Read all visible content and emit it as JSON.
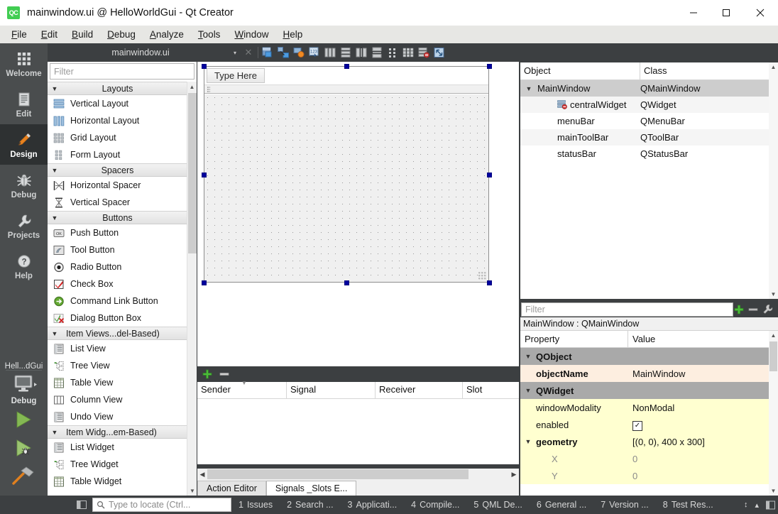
{
  "window": {
    "title": "mainwindow.ui @ HelloWorldGui - Qt Creator",
    "logo_text": "QC",
    "minimize": "—",
    "maximize": "☐",
    "close": "✕"
  },
  "menubar": {
    "items": [
      {
        "label": "File",
        "mnemonic": "F"
      },
      {
        "label": "Edit",
        "mnemonic": "E"
      },
      {
        "label": "Build",
        "mnemonic": "B"
      },
      {
        "label": "Debug",
        "mnemonic": "D"
      },
      {
        "label": "Analyze",
        "mnemonic": "A"
      },
      {
        "label": "Tools",
        "mnemonic": "T"
      },
      {
        "label": "Window",
        "mnemonic": "W"
      },
      {
        "label": "Help",
        "mnemonic": "H"
      }
    ]
  },
  "modebar": {
    "modes": [
      {
        "label": "Welcome",
        "icon": "grid-icon",
        "active": false
      },
      {
        "label": "Edit",
        "icon": "document-icon",
        "active": false
      },
      {
        "label": "Design",
        "icon": "pencil-icon",
        "active": true
      },
      {
        "label": "Debug",
        "icon": "bug-icon",
        "active": false
      },
      {
        "label": "Projects",
        "icon": "wrench-icon",
        "active": false
      },
      {
        "label": "Help",
        "icon": "question-icon",
        "active": false
      }
    ],
    "kit": {
      "project": "Hell...dGui",
      "build_config": "Debug",
      "icon": "monitor-icon",
      "run_label": "run-button",
      "debug_label": "start-debugging-button",
      "build_label": "build-button"
    }
  },
  "editor_toolbar": {
    "open_file": "mainwindow.ui",
    "dropdown_arrow": "▾",
    "close_editor": "✕",
    "tools": [
      {
        "name": "edit-widgets-icon"
      },
      {
        "name": "edit-signals-slots-icon"
      },
      {
        "name": "edit-buddies-icon"
      },
      {
        "name": "edit-tab-order-icon"
      },
      {
        "name": "layout-horizontally-icon"
      },
      {
        "name": "layout-vertically-icon"
      },
      {
        "name": "layout-in-splitter-horizontal-icon"
      },
      {
        "name": "layout-in-splitter-vertical-icon"
      },
      {
        "name": "layout-in-form-icon"
      },
      {
        "name": "layout-in-grid-icon"
      },
      {
        "name": "break-layout-icon"
      },
      {
        "name": "adjust-size-icon"
      }
    ]
  },
  "widget_box": {
    "filter_placeholder": "Filter",
    "groups": [
      {
        "title": "Layouts",
        "expanded": true,
        "items": [
          {
            "label": "Vertical Layout",
            "icon": "vertical-layout-icon"
          },
          {
            "label": "Horizontal Layout",
            "icon": "horizontal-layout-icon"
          },
          {
            "label": "Grid Layout",
            "icon": "grid-layout-icon"
          },
          {
            "label": "Form Layout",
            "icon": "form-layout-icon"
          }
        ]
      },
      {
        "title": "Spacers",
        "expanded": true,
        "items": [
          {
            "label": "Horizontal Spacer",
            "icon": "horizontal-spacer-icon"
          },
          {
            "label": "Vertical Spacer",
            "icon": "vertical-spacer-icon"
          }
        ]
      },
      {
        "title": "Buttons",
        "expanded": true,
        "items": [
          {
            "label": "Push Button",
            "icon": "push-button-icon"
          },
          {
            "label": "Tool Button",
            "icon": "tool-button-icon"
          },
          {
            "label": "Radio Button",
            "icon": "radio-button-icon"
          },
          {
            "label": "Check Box",
            "icon": "check-box-icon"
          },
          {
            "label": "Command Link Button",
            "icon": "command-link-button-icon"
          },
          {
            "label": "Dialog Button Box",
            "icon": "dialog-button-box-icon"
          }
        ]
      },
      {
        "title": "Item Views...del-Based)",
        "expanded": true,
        "items": [
          {
            "label": "List View",
            "icon": "list-view-icon"
          },
          {
            "label": "Tree View",
            "icon": "tree-view-icon"
          },
          {
            "label": "Table View",
            "icon": "table-view-icon"
          },
          {
            "label": "Column View",
            "icon": "column-view-icon"
          },
          {
            "label": "Undo View",
            "icon": "undo-view-icon"
          }
        ]
      },
      {
        "title": "Item Widg...em-Based)",
        "expanded": true,
        "items": [
          {
            "label": "List Widget",
            "icon": "list-widget-icon"
          },
          {
            "label": "Tree Widget",
            "icon": "tree-widget-icon"
          },
          {
            "label": "Table Widget",
            "icon": "table-widget-icon"
          }
        ]
      }
    ]
  },
  "form_editor": {
    "menu_placeholder": "Type Here",
    "selected": true
  },
  "signals_slots": {
    "add_button": "+",
    "remove_button": "–",
    "columns": [
      "Sender",
      "Signal",
      "Receiver",
      "Slot"
    ],
    "rows": [],
    "tabs": [
      {
        "label": "Action Editor",
        "active": false
      },
      {
        "label": "Signals _Slots E...",
        "active": true
      }
    ]
  },
  "object_inspector": {
    "columns": [
      "Object",
      "Class"
    ],
    "rows": [
      {
        "object": "MainWindow",
        "class": "QMainWindow",
        "indent": 0,
        "expanded": true,
        "selected": true,
        "icon": ""
      },
      {
        "object": "centralWidget",
        "class": "QWidget",
        "indent": 2,
        "expanded": false,
        "selected": false,
        "icon": "central-widget-icon"
      },
      {
        "object": "menuBar",
        "class": "QMenuBar",
        "indent": 1,
        "expanded": false,
        "selected": false,
        "icon": ""
      },
      {
        "object": "mainToolBar",
        "class": "QToolBar",
        "indent": 1,
        "expanded": false,
        "selected": false,
        "icon": ""
      },
      {
        "object": "statusBar",
        "class": "QStatusBar",
        "indent": 1,
        "expanded": false,
        "selected": false,
        "icon": ""
      }
    ]
  },
  "property_editor": {
    "filter_placeholder": "Filter",
    "add_button": "add-property-icon",
    "remove_button": "remove-property-icon",
    "configure_button": "configure-icon",
    "class_line": "MainWindow : QMainWindow",
    "columns": [
      "Property",
      "Value"
    ],
    "rows": [
      {
        "kind": "group",
        "name": "QObject",
        "value": "",
        "expanded": true
      },
      {
        "kind": "prop",
        "name": "objectName",
        "value": "MainWindow",
        "bold": true,
        "highlight": "peach",
        "indent": 1
      },
      {
        "kind": "group",
        "name": "QWidget",
        "value": "",
        "expanded": true
      },
      {
        "kind": "prop",
        "name": "windowModality",
        "value": "NonModal",
        "bold": false,
        "highlight": "yellow",
        "indent": 1
      },
      {
        "kind": "checkbox",
        "name": "enabled",
        "value": "✓",
        "bold": false,
        "highlight": "yellow",
        "indent": 1
      },
      {
        "kind": "prop",
        "name": "geometry",
        "value": "[(0, 0), 400 x 300]",
        "bold": true,
        "highlight": "yellow",
        "indent": 1,
        "expanded": true
      },
      {
        "kind": "subprop",
        "name": "X",
        "value": "0",
        "highlight": "yellow",
        "indent": 2
      },
      {
        "kind": "subprop",
        "name": "Y",
        "value": "0",
        "highlight": "yellow",
        "indent": 2
      }
    ]
  },
  "statusbar": {
    "toggle_sidebar": "toggle-sidebar-icon",
    "locator_placeholder": "Type to locate (Ctrl...",
    "search_icon": "search-icon",
    "panes": [
      {
        "num": "1",
        "label": "Issues"
      },
      {
        "num": "2",
        "label": "Search ..."
      },
      {
        "num": "3",
        "label": "Applicati..."
      },
      {
        "num": "4",
        "label": "Compile..."
      },
      {
        "num": "5",
        "label": "QML De..."
      },
      {
        "num": "6",
        "label": "General ..."
      },
      {
        "num": "7",
        "label": "Version ..."
      },
      {
        "num": "8",
        "label": "Test Res..."
      }
    ],
    "resize_icon": "↕",
    "collapse_icon": "▴",
    "panel_icon": "output-panel-icon"
  },
  "colors": {
    "chrome_dark": "#3c3f41",
    "modebar": "#4a4d4e",
    "mode_active": "#2e3132",
    "accent_orange": "#e07a28",
    "accent_green": "#41cd52",
    "selection_gray": "#cdcdcd",
    "property_peach": "#fdeee0",
    "property_yellow": "#ffffd0",
    "group_gray": "#a9a9a9",
    "handle_blue": "#00009f"
  }
}
